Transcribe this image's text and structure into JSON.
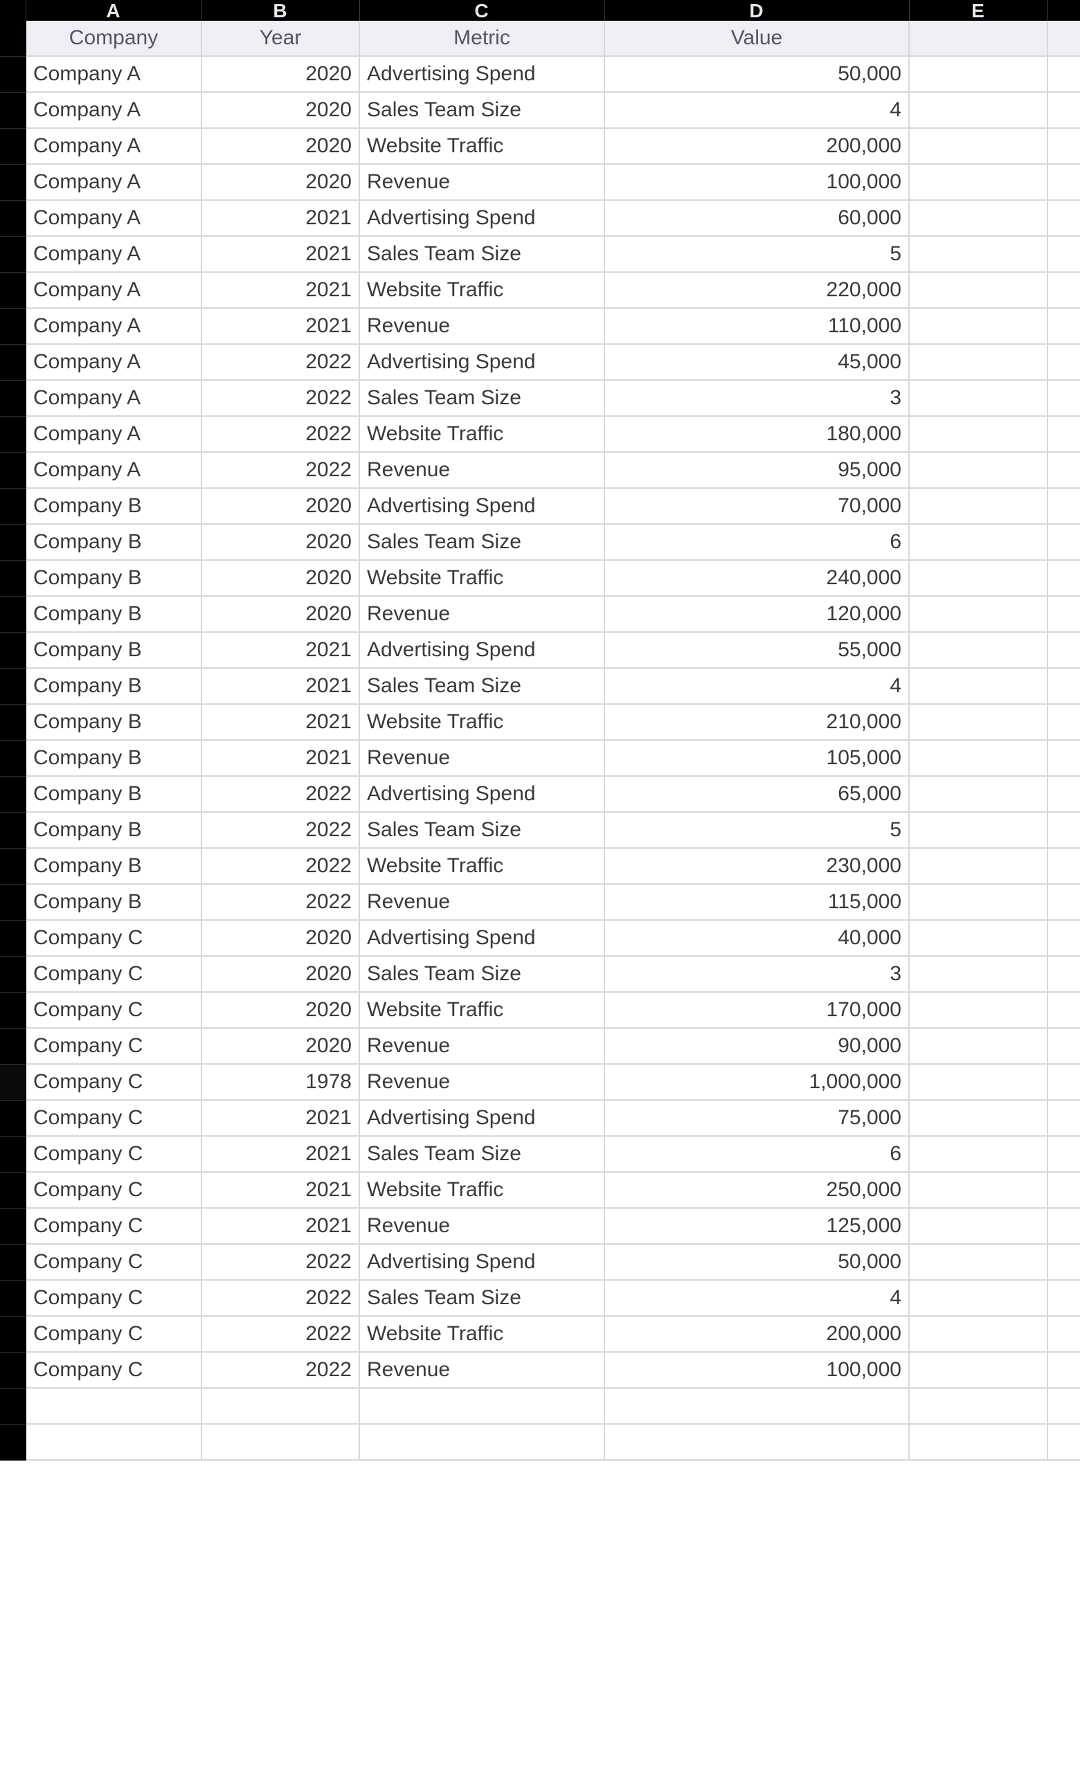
{
  "columns": [
    "A",
    "B",
    "C",
    "D",
    "E"
  ],
  "headers": {
    "A": "Company",
    "B": "Year",
    "C": "Metric",
    "D": "Value"
  },
  "col_widths_class": {
    "A": "w-a",
    "B": "w-b",
    "C": "w-c",
    "D": "w-d",
    "E": "w-e",
    "F": "w-f"
  },
  "selected_row_index": 29,
  "rows": [
    {
      "company": "Company A",
      "year": "2020",
      "metric": "Advertising Spend",
      "value": "50,000"
    },
    {
      "company": "Company A",
      "year": "2020",
      "metric": "Sales Team Size",
      "value": "4"
    },
    {
      "company": "Company A",
      "year": "2020",
      "metric": "Website Traffic",
      "value": "200,000"
    },
    {
      "company": "Company A",
      "year": "2020",
      "metric": "Revenue",
      "value": "100,000"
    },
    {
      "company": "Company A",
      "year": "2021",
      "metric": "Advertising Spend",
      "value": "60,000"
    },
    {
      "company": "Company A",
      "year": "2021",
      "metric": "Sales Team Size",
      "value": "5"
    },
    {
      "company": "Company A",
      "year": "2021",
      "metric": "Website Traffic",
      "value": "220,000"
    },
    {
      "company": "Company A",
      "year": "2021",
      "metric": "Revenue",
      "value": "110,000"
    },
    {
      "company": "Company A",
      "year": "2022",
      "metric": "Advertising Spend",
      "value": "45,000"
    },
    {
      "company": "Company A",
      "year": "2022",
      "metric": "Sales Team Size",
      "value": "3"
    },
    {
      "company": "Company A",
      "year": "2022",
      "metric": "Website Traffic",
      "value": "180,000"
    },
    {
      "company": "Company A",
      "year": "2022",
      "metric": "Revenue",
      "value": "95,000"
    },
    {
      "company": "Company B",
      "year": "2020",
      "metric": "Advertising Spend",
      "value": "70,000"
    },
    {
      "company": "Company B",
      "year": "2020",
      "metric": "Sales Team Size",
      "value": "6"
    },
    {
      "company": "Company B",
      "year": "2020",
      "metric": "Website Traffic",
      "value": "240,000"
    },
    {
      "company": "Company B",
      "year": "2020",
      "metric": "Revenue",
      "value": "120,000"
    },
    {
      "company": "Company B",
      "year": "2021",
      "metric": "Advertising Spend",
      "value": "55,000"
    },
    {
      "company": "Company B",
      "year": "2021",
      "metric": "Sales Team Size",
      "value": "4"
    },
    {
      "company": "Company B",
      "year": "2021",
      "metric": "Website Traffic",
      "value": "210,000"
    },
    {
      "company": "Company B",
      "year": "2021",
      "metric": "Revenue",
      "value": "105,000"
    },
    {
      "company": "Company B",
      "year": "2022",
      "metric": "Advertising Spend",
      "value": "65,000"
    },
    {
      "company": "Company B",
      "year": "2022",
      "metric": "Sales Team Size",
      "value": "5"
    },
    {
      "company": "Company B",
      "year": "2022",
      "metric": "Website Traffic",
      "value": "230,000"
    },
    {
      "company": "Company B",
      "year": "2022",
      "metric": "Revenue",
      "value": "115,000"
    },
    {
      "company": "Company C",
      "year": "2020",
      "metric": "Advertising Spend",
      "value": "40,000"
    },
    {
      "company": "Company C",
      "year": "2020",
      "metric": "Sales Team Size",
      "value": "3"
    },
    {
      "company": "Company C",
      "year": "2020",
      "metric": "Website Traffic",
      "value": "170,000"
    },
    {
      "company": "Company C",
      "year": "2020",
      "metric": "Revenue",
      "value": "90,000"
    },
    {
      "company": "Company C",
      "year": "1978",
      "metric": "Revenue",
      "value": "1,000,000"
    },
    {
      "company": "Company C",
      "year": "2021",
      "metric": "Advertising Spend",
      "value": "75,000"
    },
    {
      "company": "Company C",
      "year": "2021",
      "metric": "Sales Team Size",
      "value": "6"
    },
    {
      "company": "Company C",
      "year": "2021",
      "metric": "Website Traffic",
      "value": "250,000"
    },
    {
      "company": "Company C",
      "year": "2021",
      "metric": "Revenue",
      "value": "125,000"
    },
    {
      "company": "Company C",
      "year": "2022",
      "metric": "Advertising Spend",
      "value": "50,000"
    },
    {
      "company": "Company C",
      "year": "2022",
      "metric": "Sales Team Size",
      "value": "4"
    },
    {
      "company": "Company C",
      "year": "2022",
      "metric": "Website Traffic",
      "value": "200,000"
    },
    {
      "company": "Company C",
      "year": "2022",
      "metric": "Revenue",
      "value": "100,000"
    }
  ],
  "trailing_empty_rows": 2
}
